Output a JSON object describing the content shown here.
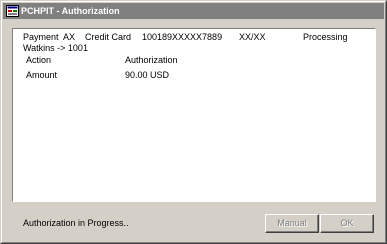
{
  "window": {
    "title": "PCHPIT - Authorization",
    "icon": "app-icon"
  },
  "payment": {
    "payment_label": "Payment",
    "method_code": "AX",
    "method_name": "Credit Card",
    "card_number": "100189XXXXX7889",
    "expiry": "XX/XX",
    "state": "Processing",
    "guest": "Watkins -> 1001"
  },
  "details": {
    "headers": {
      "col1": "Action",
      "col2": "Authorization"
    },
    "rows": [
      {
        "label": "Amount",
        "value": "90.00 USD"
      }
    ]
  },
  "status": {
    "text": "Authorization in Progress.."
  },
  "buttons": {
    "manual": "Manual",
    "ok": "OK"
  },
  "colors": {
    "titlebar_inactive": "#808080",
    "face": "#d4d0c8",
    "content_bg": "#ffffff",
    "disabled_text": "#808080"
  }
}
